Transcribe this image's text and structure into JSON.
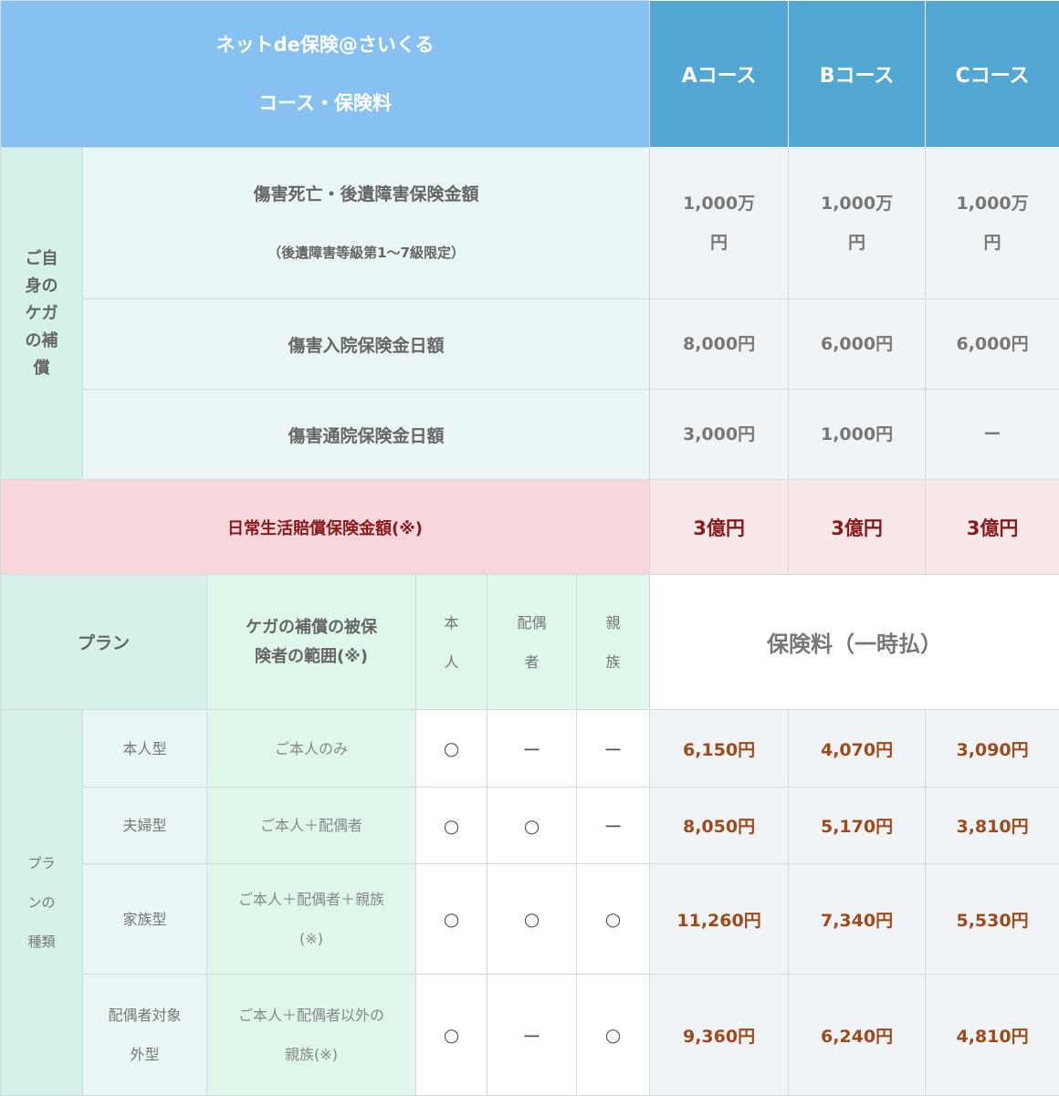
{
  "header": {
    "title_line1": "ネットde保険@さいくる",
    "title_line2": "コース・保険料",
    "courses": [
      "Aコース",
      "Bコース",
      "Cコース"
    ]
  },
  "own_injury": {
    "category_label": "ご自身のケガの補償",
    "category_lines": [
      "ご自",
      "身の",
      "ケガ",
      "の補",
      "償"
    ],
    "rows": [
      {
        "label": "傷害死亡・後遺障害保険金額",
        "sublabel": "（後遺障害等級第1〜7級限定）",
        "values": [
          {
            "line1": "1,000万",
            "line2": "円"
          },
          {
            "line1": "1,000万",
            "line2": "円"
          },
          {
            "line1": "1,000万",
            "line2": "円"
          }
        ]
      },
      {
        "label": "傷害入院保険金日額",
        "values": [
          "8,000円",
          "6,000円",
          "6,000円"
        ]
      },
      {
        "label": "傷害通院保険金日額",
        "values": [
          "3,000円",
          "1,000円",
          "ー"
        ]
      }
    ]
  },
  "liability": {
    "label": "日常生活賠償保険金額(※)",
    "values": [
      "3億円",
      "3億円",
      "3億円"
    ]
  },
  "plan_header": {
    "plan": "プラン",
    "scope_line1": "ケガの補償の被保",
    "scope_line2": "険者の範囲(※)",
    "self": [
      "本",
      "人"
    ],
    "spouse": [
      "配偶",
      "者"
    ],
    "relatives": [
      "親",
      "族"
    ],
    "premium": "保険料（一時払）"
  },
  "plan_category_lines": [
    "プラ",
    "ンの",
    "種類"
  ],
  "plans": [
    {
      "name": [
        "本人型"
      ],
      "scope": [
        "ご本人のみ"
      ],
      "marks": [
        "○",
        "ー",
        "ー"
      ],
      "prices": [
        "6,150円",
        "4,070円",
        "3,090円"
      ]
    },
    {
      "name": [
        "夫婦型"
      ],
      "scope": [
        "ご本人＋配偶者"
      ],
      "marks": [
        "○",
        "○",
        "ー"
      ],
      "prices": [
        "8,050円",
        "5,170円",
        "3,810円"
      ]
    },
    {
      "name": [
        "家族型"
      ],
      "scope": [
        "ご本人＋配偶者＋親族",
        "(※)"
      ],
      "marks": [
        "○",
        "○",
        "○"
      ],
      "prices": [
        "11,260円",
        "7,340円",
        "5,530円"
      ]
    },
    {
      "name": [
        "配偶者対象",
        "外型"
      ],
      "scope": [
        "ご本人＋配偶者以外の",
        "親族(※)"
      ],
      "marks": [
        "○",
        "ー",
        "○"
      ],
      "prices": [
        "9,360円",
        "6,240円",
        "4,810円"
      ]
    }
  ]
}
